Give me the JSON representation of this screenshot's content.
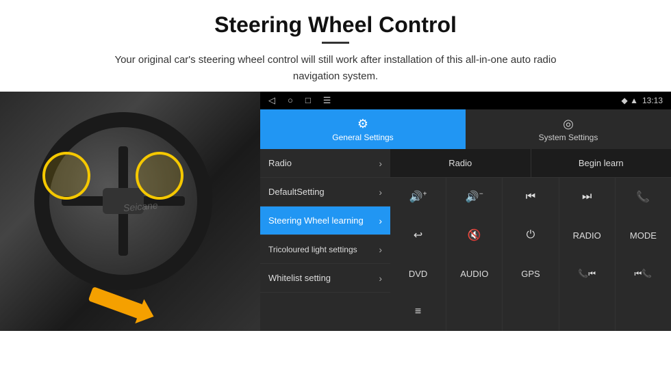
{
  "header": {
    "title": "Steering Wheel Control",
    "subtitle": "Your original car's steering wheel control will still work after installation of this all-in-one auto radio navigation system."
  },
  "status_bar": {
    "nav_icons": [
      "◁",
      "○",
      "□",
      "☰"
    ],
    "signal": "◆ ▲",
    "time": "13:13"
  },
  "tabs": {
    "general": {
      "label": "General Settings",
      "icon": "⚙"
    },
    "system": {
      "label": "System Settings",
      "icon": "◎"
    }
  },
  "menu_items": [
    {
      "label": "Radio",
      "active": false
    },
    {
      "label": "DefaultSetting",
      "active": false
    },
    {
      "label": "Steering Wheel learning",
      "active": true
    },
    {
      "label": "Tricoloured light settings",
      "active": false
    },
    {
      "label": "Whitelist setting",
      "active": false
    }
  ],
  "ctrl_top": {
    "radio_label": "Radio",
    "begin_learn_label": "Begin learn"
  },
  "ctrl_buttons_row1": [
    {
      "icon": "🔊+",
      "label": ""
    },
    {
      "icon": "🔊−",
      "label": ""
    },
    {
      "icon": "⏮",
      "label": ""
    },
    {
      "icon": "⏭",
      "label": ""
    },
    {
      "icon": "📞",
      "label": ""
    }
  ],
  "ctrl_buttons_row2": [
    {
      "icon": "↩",
      "label": ""
    },
    {
      "icon": "🔇",
      "label": ""
    },
    {
      "icon": "⏻",
      "label": ""
    },
    {
      "text": "RADIO",
      "label": ""
    },
    {
      "text": "MODE",
      "label": ""
    }
  ],
  "ctrl_buttons_row3": [
    {
      "text": "DVD",
      "label": ""
    },
    {
      "text": "AUDIO",
      "label": ""
    },
    {
      "text": "GPS",
      "label": ""
    },
    {
      "icon": "📞⏮",
      "label": ""
    },
    {
      "icon": "⏮📞",
      "label": ""
    }
  ],
  "ctrl_buttons_row4": [
    {
      "icon": "≡",
      "label": ""
    },
    {
      "label": ""
    },
    {
      "label": ""
    },
    {
      "label": ""
    },
    {
      "label": ""
    }
  ]
}
